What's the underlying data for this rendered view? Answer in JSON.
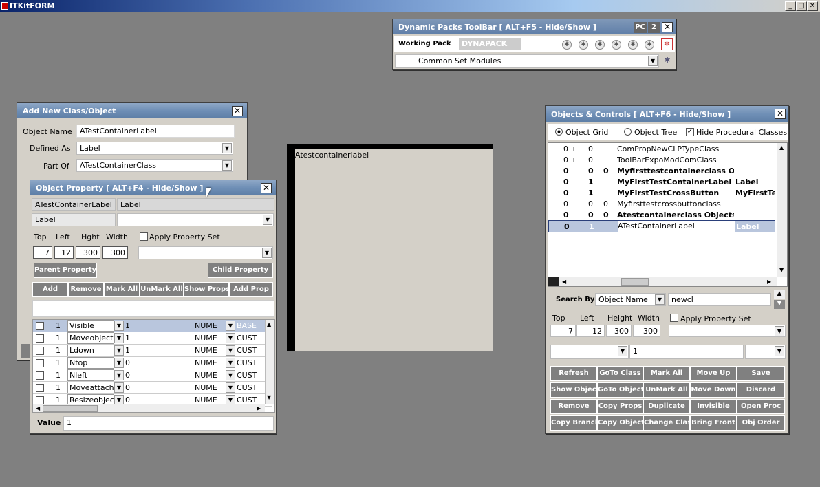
{
  "app": {
    "title": "ITKitFORM",
    "minimize": "_",
    "maximize": "□",
    "close": "✕"
  },
  "dynabar": {
    "title": "Dynamic Packs ToolBar [ ALT+F5 - Hide/Show ]",
    "pc_btn": "PC",
    "num_btn": "2",
    "close": "✕",
    "working_pack_label": "Working Pack",
    "working_pack_value": "DYNAPACK",
    "module_value": "Common Set Modules"
  },
  "addclass": {
    "title": "Add New Class/Object",
    "close": "✕",
    "object_name_label": "Object Name",
    "object_name_value": "ATestContainerLabel",
    "defined_as_label": "Defined As",
    "defined_as_value": "Label",
    "part_of_label": "Part Of",
    "part_of_value": "ATestContainerClass"
  },
  "objprop": {
    "title": "Object Property [ ALT+F4 - Hide/Show ]",
    "close": "✕",
    "name_cell": "ATestContainerLabel",
    "class_cell": "Label",
    "type_value": "Label",
    "top_label": "Top",
    "left_label": "Left",
    "hght_label": "Hght",
    "width_label": "Width",
    "top": "7",
    "left": "12",
    "hght": "300",
    "width": "300",
    "apply_label": "Apply Property Set",
    "parent_btn": "Parent Property",
    "child_btn": "Child Property",
    "buttons": [
      "Add",
      "Remove",
      "Mark All",
      "UnMark All",
      "Show Props",
      "Add Prop"
    ],
    "rows": [
      {
        "n": "1",
        "name": "Visible",
        "val": "1",
        "type": "NUME",
        "src": "BASE"
      },
      {
        "n": "1",
        "name": "Moveobject",
        "val": "1",
        "type": "NUME",
        "src": "CUST"
      },
      {
        "n": "1",
        "name": "Ldown",
        "val": "1",
        "type": "NUME",
        "src": "CUST"
      },
      {
        "n": "1",
        "name": "Ntop",
        "val": "0",
        "type": "NUME",
        "src": "CUST"
      },
      {
        "n": "1",
        "name": "Nleft",
        "val": "0",
        "type": "NUME",
        "src": "CUST"
      },
      {
        "n": "1",
        "name": "Moveattache",
        "val": "0",
        "type": "NUME",
        "src": "CUST"
      },
      {
        "n": "1",
        "name": "Resizeobject",
        "val": "0",
        "type": "NUME",
        "src": "CUST"
      }
    ],
    "value_label": "Value",
    "value": "1"
  },
  "canvas": {
    "label_text": "Atestcontainerlabel"
  },
  "objctl": {
    "title": "Objects & Controls [ ALT+F6 - Hide/Show ]",
    "close": "✕",
    "radio_grid": "Object Grid",
    "radio_tree": "Object Tree",
    "hide_proc": "Hide Procedural Classes",
    "rows": [
      {
        "a": "0 +",
        "b": "0",
        "c": "",
        "name": "ComPropNewCLPTypeClass",
        "cls": "",
        "bold": false
      },
      {
        "a": "0 +",
        "b": "0",
        "c": "",
        "name": "ToolBarExpoModComClass",
        "cls": "",
        "bold": false
      },
      {
        "a": "0",
        "b": "0",
        "c": "0",
        "name": "Myfirsttestcontainerclass Obj",
        "cls": "",
        "bold": true
      },
      {
        "a": "0",
        "b": "1",
        "c": "",
        "name": "MyFirstTestContainerLabel",
        "cls": "Label",
        "bold": true
      },
      {
        "a": "0",
        "b": "1",
        "c": "",
        "name": "MyFirstTestCrossButton",
        "cls": "MyFirstTe",
        "bold": true
      },
      {
        "a": "0",
        "b": "0",
        "c": "0",
        "name": "Myfirsttestcrossbuttonclass",
        "cls": "",
        "bold": false
      },
      {
        "a": "0",
        "b": "0",
        "c": "0",
        "name": "Atestcontainerclass Objects",
        "cls": "",
        "bold": true
      },
      {
        "a": "0",
        "b": "1",
        "c": "",
        "name": "ATestContainerLabel",
        "cls": "Label",
        "bold": false
      }
    ],
    "search_label": "Search By",
    "search_by": "Object Name",
    "search_text": "newcl",
    "top_label": "Top",
    "left_label": "Left",
    "height_label": "Height",
    "width_label": "Width",
    "top": "7",
    "left": "12",
    "height": "300",
    "width": "300",
    "apply_label": "Apply Property Set",
    "extra_value": "1",
    "buttons": [
      [
        "Refresh",
        "GoTo Class",
        "Mark All",
        "Move Up",
        "Save"
      ],
      [
        "Show Object",
        "GoTo Object",
        "UnMark All",
        "Move Down",
        "Discard"
      ],
      [
        "Remove",
        "Copy Props",
        "Duplicate",
        "Invisible",
        "Open Proc"
      ],
      [
        "Copy Branch",
        "Copy Object",
        "Change Class",
        "Bring Front",
        "Obj Order"
      ]
    ]
  }
}
